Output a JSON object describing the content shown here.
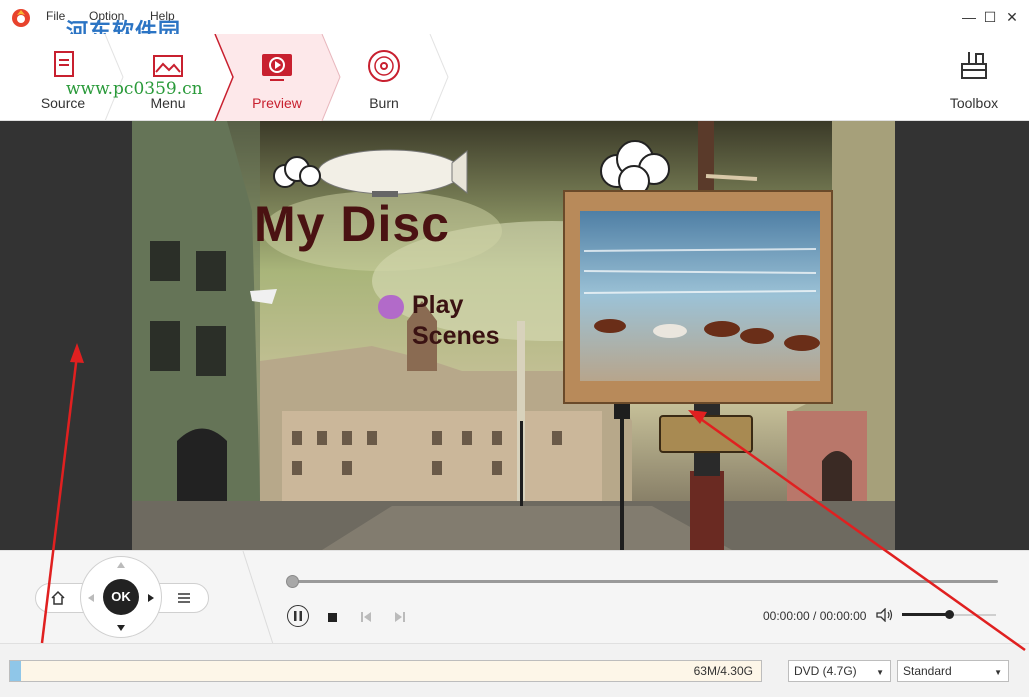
{
  "menubar": {
    "items": [
      "File",
      "Option",
      "Help"
    ],
    "watermark": "河东软件园",
    "watermark_url": "www.pc0359.cn"
  },
  "steps": [
    {
      "label": "Source",
      "icon": "document-icon",
      "active": false
    },
    {
      "label": "Menu",
      "icon": "menu-template-icon",
      "active": false
    },
    {
      "label": "Preview",
      "icon": "play-screen-icon",
      "active": true
    },
    {
      "label": "Burn",
      "icon": "disc-icon",
      "active": false
    }
  ],
  "toolbox": {
    "label": "Toolbox",
    "icon": "toolbox-icon"
  },
  "disc_menu": {
    "title": "My Disc",
    "items": [
      "Play",
      "Scenes"
    ]
  },
  "remote": {
    "home_icon": "home-icon",
    "ok_label": "OK",
    "list_icon": "list-icon"
  },
  "playback": {
    "progress": 0,
    "timecode": "00:00:00 / 00:00:00",
    "volume": 0.5
  },
  "status": {
    "capacity_text": "63M/4.30G",
    "capacity_fraction": 0.015,
    "disc_type": "DVD (4.7G)",
    "quality": "Standard"
  },
  "colors": {
    "accent": "#c8202f",
    "annotation_arrow": "#e02020"
  }
}
